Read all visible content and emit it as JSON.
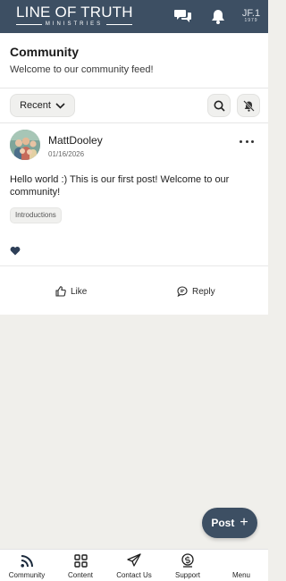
{
  "header": {
    "brand_main": "LINE OF TRUTH",
    "brand_sub": "MINISTRIES",
    "logo_mark_top": "JF.1",
    "logo_mark_bottom": "1979"
  },
  "community": {
    "title": "Community",
    "subtitle": "Welcome to our community feed!"
  },
  "filter": {
    "sort_label": "Recent"
  },
  "post": {
    "author": "MattDooley",
    "date": "01/16/2026",
    "body": "Hello world :) This is our first post! Welcome to our community!",
    "tag": "Introductions",
    "like_label": "Like",
    "reply_label": "Reply"
  },
  "fab": {
    "label": "Post",
    "plus": "+"
  },
  "nav": {
    "items": [
      {
        "label": "Community",
        "icon": "rss-icon"
      },
      {
        "label": "Content",
        "icon": "grid-icon"
      },
      {
        "label": "Contact Us",
        "icon": "send-icon"
      },
      {
        "label": "Support",
        "icon": "dollar-icon"
      },
      {
        "label": "Menu",
        "icon": "menu-icon"
      }
    ]
  },
  "colors": {
    "brand": "#3d4f63",
    "background": "#f0efeb",
    "heart": "#2e3f58"
  }
}
